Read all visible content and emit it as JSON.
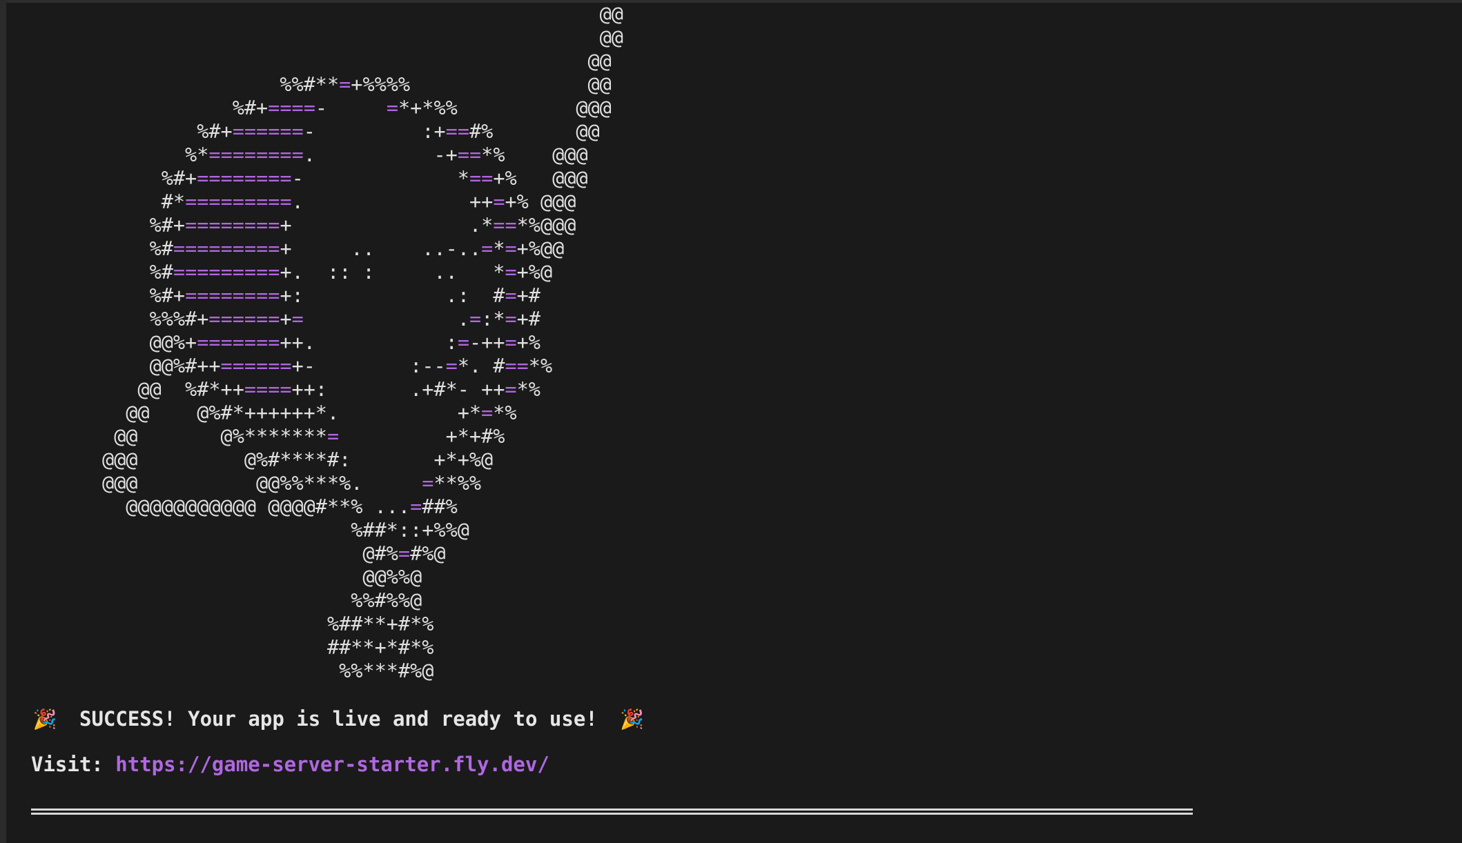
{
  "terminal": {
    "ascii_art_lines": [
      "                                                @@",
      "                                                @@",
      "                                               @@",
      "                     %%#**=+%%%%               @@",
      "                 %#+====-     =*+*%%          @@@",
      "              %#+======-         :+==#%       @@",
      "             %*========.          -+==*%    @@@",
      "           %#+========-             *==+%   @@@",
      "           #*=========.              ++=+% @@@",
      "          %#+========+               .*==*%@@@",
      "          %#=========+     ..    ..-..=*=+%@@",
      "          %#=========+.  :: :     ..   *=+%@",
      "          %#+========+:            .:  #=+#",
      "          %%%#+======+=             .=:*=+#",
      "          @@%+=======++.           :=-++=+%",
      "          @@%#++======+-        :--=*. #==*%",
      "         @@  %#*++====++:       .+#*- ++=*%",
      "        @@    @%#*++++++*.          +*=*%",
      "       @@       @%*******=         +*+#%",
      "      @@@         @%#****#:       +*+%@",
      "      @@@          @@%%***%.     =**%%",
      "        @@@@@@@@@@@ @@@@#**% ...=##%",
      "                           %##*::+%%@",
      "                            @#%=#%@",
      "                            @@%%@",
      "                           %%#%%@",
      "                         %##**+#*%",
      "                         ##**+*#*%",
      "                          %%***#%@"
    ],
    "success": {
      "emoji_left": "🎉",
      "text": "SUCCESS! Your app is live and ready to use!",
      "emoji_right": "🎉"
    },
    "visit": {
      "label": "Visit:",
      "url": "https://game-server-starter.fly.dev/"
    }
  },
  "colors": {
    "background": "#1a1a1a",
    "text": "#e0e0e0",
    "accent": "#b067e0"
  }
}
